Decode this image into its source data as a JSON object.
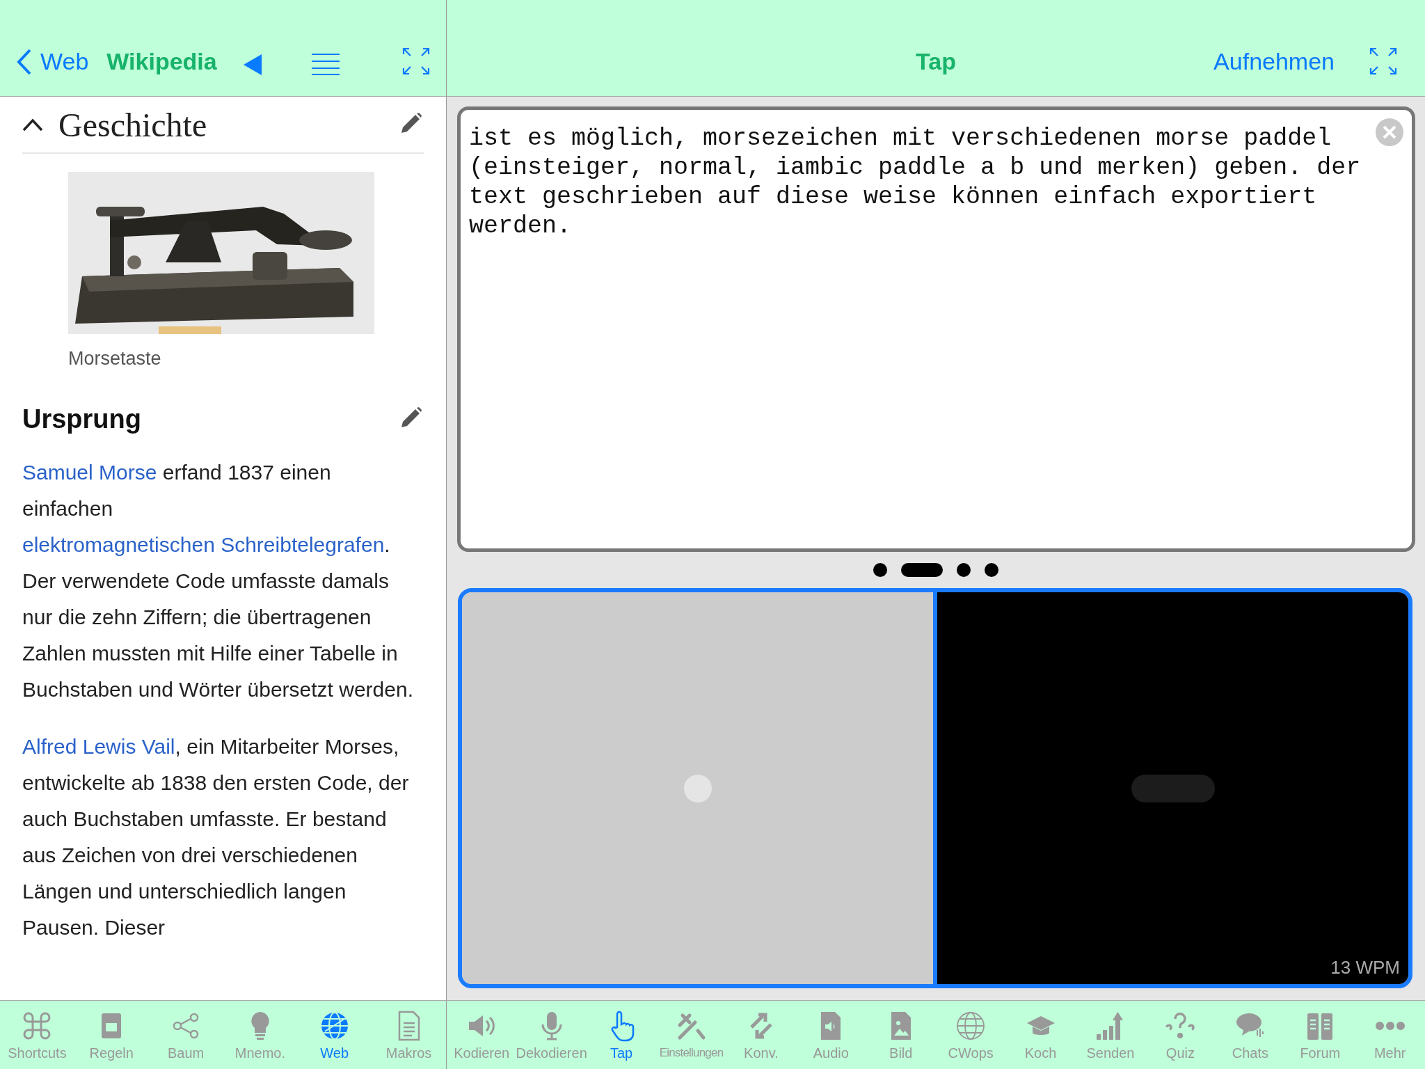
{
  "left_nav": {
    "back_label": "Web",
    "title": "Wikipedia"
  },
  "article": {
    "section_title": "Geschichte",
    "expanded": true,
    "image_caption": "Morsetaste",
    "subsection_title": "Ursprung",
    "paragraphs": [
      [
        {
          "text": "Samuel Morse",
          "link": true
        },
        {
          "text": " erfand 1837 einen einfachen ",
          "link": false
        },
        {
          "text": "elektromagnetischen Schreibtelegrafen",
          "link": true
        },
        {
          "text": ". Der verwendete Code umfasste damals nur die zehn Ziffern; die übertragenen Zahlen mussten mit Hilfe einer Tabelle in Buchstaben und Wörter übersetzt werden.",
          "link": false
        }
      ],
      [
        {
          "text": "Alfred Lewis Vail",
          "link": true
        },
        {
          "text": ", ein Mitarbeiter Morses, entwickelte ab 1838 den ersten Code, der auch Buchstaben umfasste. Er bestand aus Zeichen von drei verschiedenen Längen und unterschiedlich langen Pausen. Dieser",
          "link": false
        }
      ]
    ]
  },
  "right_nav": {
    "title": "Tap",
    "action": "Aufnehmen"
  },
  "text_area": {
    "value": "ist es möglich, morsezeichen mit verschiedenen morse paddel (einsteiger, normal, iambic paddle a b und merken) geben. der text geschrieben auf diese weise können einfach exportiert werden."
  },
  "morse_preview": [
    {
      "kind": "dot"
    },
    {
      "kind": "dash"
    },
    {
      "kind": "dot"
    },
    {
      "kind": "dot"
    }
  ],
  "tap_pads": [
    {
      "kind": "dot"
    },
    {
      "kind": "dash"
    }
  ],
  "speed": "13 WPM",
  "left_tabs": [
    {
      "label": "Shortcuts",
      "selected": false
    },
    {
      "label": "Regeln",
      "selected": false
    },
    {
      "label": "Baum",
      "selected": false
    },
    {
      "label": "Mnemo.",
      "selected": false
    },
    {
      "label": "Web",
      "selected": true
    },
    {
      "label": "Makros",
      "selected": false
    }
  ],
  "right_tabs": [
    {
      "label": "Kodieren",
      "selected": false
    },
    {
      "label": "Dekodieren",
      "selected": false
    },
    {
      "label": "Tap",
      "selected": true
    },
    {
      "label": "Einstellungen",
      "selected": false
    },
    {
      "label": "Konv.",
      "selected": false
    },
    {
      "label": "Audio",
      "selected": false
    },
    {
      "label": "Bild",
      "selected": false
    },
    {
      "label": "CWops",
      "selected": false
    },
    {
      "label": "Koch",
      "selected": false
    },
    {
      "label": "Senden",
      "selected": false
    },
    {
      "label": "Quiz",
      "selected": false
    },
    {
      "label": "Chats",
      "selected": false
    },
    {
      "label": "Forum",
      "selected": false
    },
    {
      "label": "Mehr",
      "selected": false
    }
  ]
}
